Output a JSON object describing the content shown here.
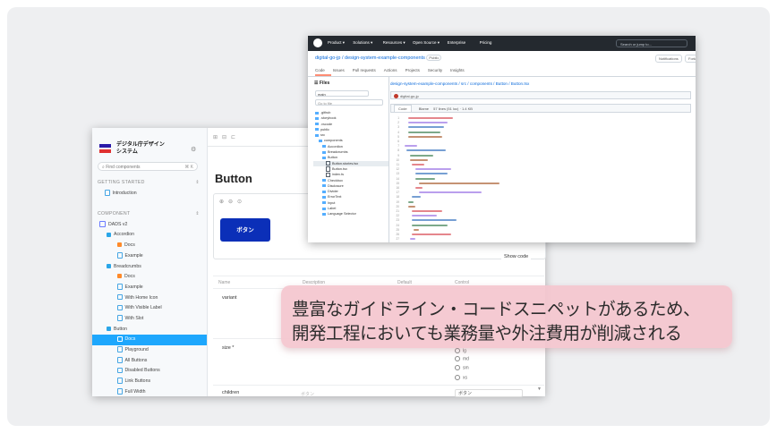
{
  "storybook": {
    "brand": "デジタル庁デザイン\nシステム",
    "find_placeholder": "Find components",
    "find_shortcut": "⌘ K",
    "nav": [
      {
        "label": "GETTING STARTED",
        "type": "section"
      },
      {
        "label": "Introduction",
        "type": "doc"
      },
      {
        "label": "",
        "type": "spacer"
      },
      {
        "label": "COMPONENT",
        "type": "section"
      },
      {
        "label": "DADS v2",
        "type": "folder"
      },
      {
        "label": "Accordion",
        "type": "comp"
      },
      {
        "label": "Docs",
        "type": "docorange"
      },
      {
        "label": "Example",
        "type": "doc"
      },
      {
        "label": "Breadcrumbs",
        "type": "comp"
      },
      {
        "label": "Docs",
        "type": "docorange"
      },
      {
        "label": "Example",
        "type": "doc"
      },
      {
        "label": "With Home Icon",
        "type": "doc"
      },
      {
        "label": "With Visible Label",
        "type": "doc"
      },
      {
        "label": "With Slot",
        "type": "doc"
      },
      {
        "label": "Button",
        "type": "comp"
      },
      {
        "label": "Docs",
        "type": "active"
      },
      {
        "label": "Playground",
        "type": "doc"
      },
      {
        "label": "All Buttons",
        "type": "doc"
      },
      {
        "label": "Disabled Buttons",
        "type": "doc"
      },
      {
        "label": "Link Buttons",
        "type": "doc"
      },
      {
        "label": "Full Width",
        "type": "doc"
      }
    ],
    "page_title": "Button",
    "demo_button": "ボタン",
    "show_code": "Show code",
    "arg_headers": [
      "Name",
      "Description",
      "Default",
      "Control"
    ],
    "args": [
      "variant",
      "size *",
      "children"
    ],
    "size_options": [
      "lg",
      "md",
      "sm",
      "xs"
    ],
    "children_default": "ボタン"
  },
  "github": {
    "nav": [
      "Product",
      "Solutions",
      "Resources",
      "Open Source",
      "Enterprise",
      "Pricing"
    ],
    "search_placeholder": "Search or jump to...",
    "repo": "digital-go-jp / design-system-example-components",
    "repo_badge": "Public",
    "chips": [
      "Notifications",
      "Fork"
    ],
    "tabs": [
      "Code",
      "Issues",
      "Pull requests",
      "Actions",
      "Projects",
      "Security",
      "Insights"
    ],
    "files_title": "Files",
    "branch": "main",
    "goto_file": "Go to file",
    "tree": [
      {
        "label": ".github",
        "kind": "folder"
      },
      {
        "label": ".storybook",
        "kind": "folder"
      },
      {
        "label": ".vscode",
        "kind": "folder"
      },
      {
        "label": "public",
        "kind": "folder"
      },
      {
        "label": "src",
        "kind": "folder"
      },
      {
        "label": "components",
        "kind": "folder"
      },
      {
        "label": "Accordion",
        "kind": "folder"
      },
      {
        "label": "Breadcrumbs",
        "kind": "folder"
      },
      {
        "label": "Button",
        "kind": "folder"
      },
      {
        "label": "Button.stories.tsx",
        "kind": "file",
        "selected": true
      },
      {
        "label": "Button.tsx",
        "kind": "file"
      },
      {
        "label": "index.ts",
        "kind": "file"
      },
      {
        "label": "Checkbox",
        "kind": "folder"
      },
      {
        "label": "Disclosure",
        "kind": "folder"
      },
      {
        "label": "Divider",
        "kind": "folder"
      },
      {
        "label": "ErrorText",
        "kind": "folder"
      },
      {
        "label": "Input",
        "kind": "folder"
      },
      {
        "label": "Label",
        "kind": "folder"
      },
      {
        "label": "Language Selector",
        "kind": "folder"
      }
    ],
    "path": "design-system-example-components / src / components / Button / Button.tsx",
    "commit_user": "digital-go-jp",
    "code_tabs": [
      "Code",
      "Blame"
    ],
    "code_meta": "57 lines (51 loc) · 1.4 KB"
  },
  "callout": {
    "line1": "豊富なガイドライン・コードスニペットがあるため、",
    "line2": "開発工程においても業務量や外注費用が削減される"
  },
  "colors": {
    "callout_bg": "#f4c6ce",
    "primary_button": "#0b2fb8",
    "active_nav": "#1ea7fd",
    "github_header": "#24292f"
  }
}
